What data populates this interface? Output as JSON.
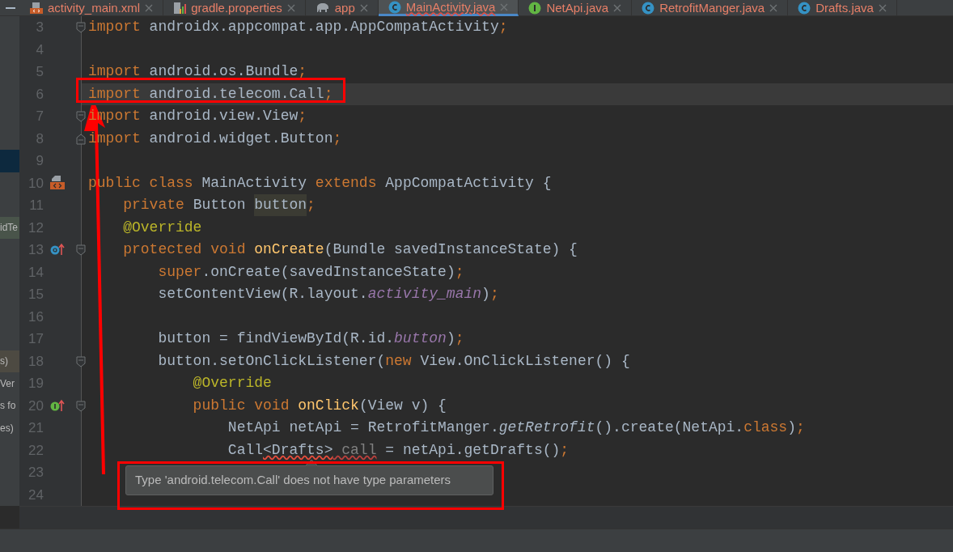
{
  "tabs": [
    {
      "label": "activity_main.xml",
      "kind": "xml",
      "selected": false,
      "error": false
    },
    {
      "label": "gradle.properties",
      "kind": "chart",
      "selected": false,
      "error": false
    },
    {
      "label": "app",
      "kind": "elephant",
      "selected": false,
      "error": false
    },
    {
      "label": "MainActivity.java",
      "kind": "class",
      "selected": true,
      "error": true
    },
    {
      "label": "NetApi.java",
      "kind": "interface",
      "selected": false,
      "error": false
    },
    {
      "label": "RetrofitManger.java",
      "kind": "class",
      "selected": false,
      "error": false
    },
    {
      "label": "Drafts.java",
      "kind": "class",
      "selected": false,
      "error": false
    }
  ],
  "editor": {
    "lines": [
      {
        "number": "3",
        "current": false,
        "markers": [
          {
            "kind": "fold-start"
          }
        ],
        "tokens": [
          {
            "text": "import",
            "kind": "keyword"
          },
          {
            "text": " androidx.appcompat.app.AppCompatActivity",
            "kind": "plain"
          },
          {
            "text": ";",
            "kind": "keyword"
          }
        ]
      },
      {
        "number": "4",
        "current": false
      },
      {
        "number": "5",
        "current": false,
        "tokens": [
          {
            "text": "import",
            "kind": "keyword"
          },
          {
            "text": " android.os.Bundle",
            "kind": "plain"
          },
          {
            "text": ";",
            "kind": "keyword"
          }
        ]
      },
      {
        "number": "6",
        "current": true,
        "tokens": [
          {
            "text": "import",
            "kind": "keyword"
          },
          {
            "text": " android.telecom.Call",
            "kind": "plain"
          },
          {
            "text": ";",
            "kind": "keyword"
          }
        ]
      },
      {
        "number": "7",
        "current": false,
        "markers": [
          {
            "kind": "fold-start"
          }
        ],
        "tokens": [
          {
            "text": "import",
            "kind": "keyword"
          },
          {
            "text": " android.view.View",
            "kind": "plain"
          },
          {
            "text": ";",
            "kind": "keyword"
          }
        ]
      },
      {
        "number": "8",
        "current": false,
        "markers": [
          {
            "kind": "fold-end"
          }
        ],
        "tokens": [
          {
            "text": "import",
            "kind": "keyword"
          },
          {
            "text": " android.widget.Button",
            "kind": "plain"
          },
          {
            "text": ";",
            "kind": "keyword"
          }
        ]
      },
      {
        "number": "9",
        "current": false,
        "side": {
          "kind": "selection"
        }
      },
      {
        "number": "10",
        "current": false,
        "markers": [
          {
            "kind": "class"
          }
        ],
        "tokens": [
          {
            "text": "public class",
            "kind": "keyword"
          },
          {
            "text": " MainActivity ",
            "kind": "plain"
          },
          {
            "text": "extends",
            "kind": "keyword"
          },
          {
            "text": " AppCompatActivity {",
            "kind": "plain"
          }
        ]
      },
      {
        "number": "11",
        "current": false,
        "tokens": [
          {
            "text": "    private",
            "kind": "keyword"
          },
          {
            "text": " Button ",
            "kind": "plain"
          },
          {
            "text": "button",
            "kind": "match"
          },
          {
            "text": ";",
            "kind": "keyword"
          }
        ]
      },
      {
        "number": "12",
        "current": false,
        "side": {
          "kind": "usage",
          "text": "idTe"
        },
        "tokens": [
          {
            "text": "    @Override",
            "kind": "annotation"
          }
        ]
      },
      {
        "number": "13",
        "current": false,
        "markers": [
          {
            "kind": "override"
          },
          {
            "kind": "fold-start"
          }
        ],
        "tokens": [
          {
            "text": "    protected void",
            "kind": "keyword"
          },
          {
            "text": " onCreate",
            "kind": "method"
          },
          {
            "text": "(Bundle savedInstanceState) {",
            "kind": "plain"
          }
        ]
      },
      {
        "number": "14",
        "current": false,
        "tokens": [
          {
            "text": "        super",
            "kind": "keyword"
          },
          {
            "text": ".onCreate(savedInstanceState)",
            "kind": "plain"
          },
          {
            "text": ";",
            "kind": "keyword"
          }
        ]
      },
      {
        "number": "15",
        "current": false,
        "tokens": [
          {
            "text": "        setContentView(R.layout.",
            "kind": "plain"
          },
          {
            "text": "activity_main",
            "kind": "field"
          },
          {
            "text": ")",
            "kind": "plain"
          },
          {
            "text": ";",
            "kind": "keyword"
          }
        ]
      },
      {
        "number": "16",
        "current": false
      },
      {
        "number": "17",
        "current": false,
        "tokens": [
          {
            "text": "        button = findViewById(R.id.",
            "kind": "plain"
          },
          {
            "text": "button",
            "kind": "field"
          },
          {
            "text": ")",
            "kind": "plain"
          },
          {
            "text": ";",
            "kind": "keyword"
          }
        ]
      },
      {
        "number": "18",
        "current": false,
        "side": {
          "kind": "note",
          "text": "s)"
        },
        "markers": [
          {
            "kind": "fold-start"
          }
        ],
        "tokens": [
          {
            "text": "        button.setOnClickListener(",
            "kind": "plain"
          },
          {
            "text": "new",
            "kind": "keyword"
          },
          {
            "text": " View.OnClickListener() {",
            "kind": "plain"
          }
        ]
      },
      {
        "number": "19",
        "current": false,
        "side": {
          "kind": "text",
          "text": "Ver"
        },
        "tokens": [
          {
            "text": "            @Override",
            "kind": "annotation"
          }
        ]
      },
      {
        "number": "20",
        "current": false,
        "side": {
          "kind": "text",
          "text": "s fo"
        },
        "markers": [
          {
            "kind": "implement"
          },
          {
            "kind": "fold-start"
          }
        ],
        "tokens": [
          {
            "text": "            public void",
            "kind": "keyword"
          },
          {
            "text": " onClick",
            "kind": "method"
          },
          {
            "text": "(View v) {",
            "kind": "plain"
          }
        ]
      },
      {
        "number": "21",
        "current": false,
        "side": {
          "kind": "text",
          "text": "es)"
        },
        "tokens": [
          {
            "text": "                NetApi netApi = RetrofitManger.",
            "kind": "plain"
          },
          {
            "text": "getRetrofit",
            "kind": "static"
          },
          {
            "text": "().create(NetApi.",
            "kind": "plain"
          },
          {
            "text": "class",
            "kind": "keyword"
          },
          {
            "text": ")",
            "kind": "plain"
          },
          {
            "text": ";",
            "kind": "keyword"
          }
        ]
      },
      {
        "number": "22",
        "current": false,
        "tokens": [
          {
            "text": "                Call",
            "kind": "plain"
          },
          {
            "text": "<Drafts>",
            "kind": "error"
          },
          {
            "text": " call",
            "kind": "unused"
          },
          {
            "text": " = netApi.getDrafts()",
            "kind": "plain"
          },
          {
            "text": ";",
            "kind": "keyword"
          }
        ]
      },
      {
        "number": "23",
        "current": false
      },
      {
        "number": "24",
        "current": false
      }
    ]
  },
  "tooltip": {
    "text": "Type 'android.telecom.Call' does not have type parameters"
  },
  "annotations": [
    {
      "kind": "line-box"
    },
    {
      "kind": "arrow"
    },
    {
      "kind": "tooltip-box"
    }
  ]
}
